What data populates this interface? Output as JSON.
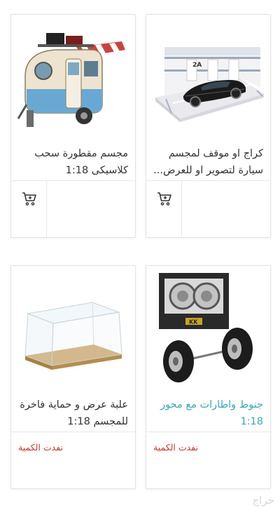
{
  "products": [
    {
      "name_line1": "كراج او موقف لمجسم",
      "name_line2": "سيارة لتصوير او للعرض...",
      "image_label": "2A",
      "action": "add-to-cart"
    },
    {
      "name_line1": "مجسم مقطورة سحب",
      "name_line2": "كلاسيكى 1:18",
      "action": "add-to-cart"
    },
    {
      "name_line1": "جنوط واطارات مع محور",
      "name_line2": "1:18",
      "image_label": "KK",
      "status": "نفدت الكمية"
    },
    {
      "name_line1": "علبة عرض و حماية فاخرة",
      "name_line2": "للمجسم 1:18",
      "status": "نفدت الكمية"
    }
  ],
  "watermark": "حراج",
  "colors": {
    "link": "#3aa6b9",
    "soldout": "#c0392b",
    "text": "#333333"
  }
}
